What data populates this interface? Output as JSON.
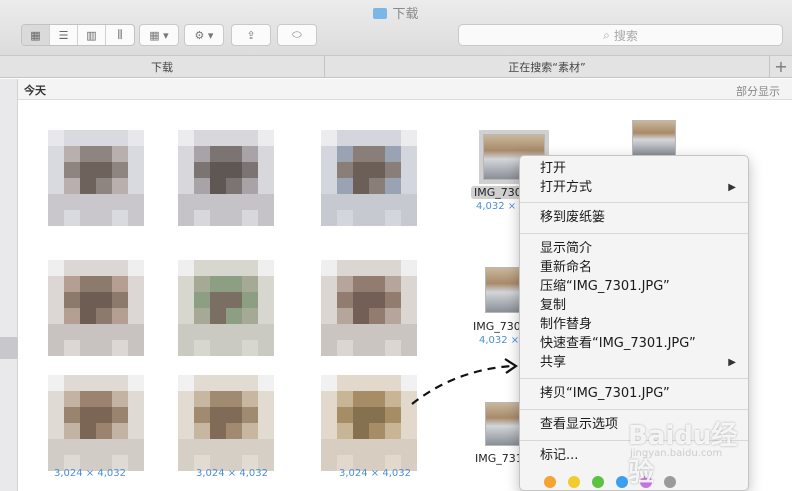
{
  "window": {
    "title": "下载"
  },
  "search": {
    "placeholder": "搜索"
  },
  "tabs": [
    {
      "label": "下载"
    },
    {
      "label": "正在搜索“素材”"
    }
  ],
  "section": {
    "title": "今天",
    "show_less": "部分显示"
  },
  "files": {
    "dims_a": "4,032 × 3,024",
    "dims_b": "3,024 × 4,032",
    "dims_trunc": "4,032 ×",
    "name_1": "IMG_730",
    "name_2": "IMG_730",
    "name_3": "IMG_731"
  },
  "menu": {
    "open": "打开",
    "open_with": "打开方式",
    "trash": "移到废纸篓",
    "get_info": "显示简介",
    "rename": "重新命名",
    "compress": "压缩“IMG_7301.JPG”",
    "duplicate": "复制",
    "make_alias": "制作替身",
    "quick_look": "快速查看“IMG_7301.JPG”",
    "share": "共享",
    "copy": "拷贝“IMG_7301.JPG”",
    "view_options": "查看显示选项",
    "tags": "标记..."
  },
  "tag_colors": [
    "#f5a331",
    "#f2cb2c",
    "#5cc244",
    "#3a9ff0",
    "#c474e6",
    "#9b9b9b"
  ],
  "watermark": {
    "brand": "Baidu经验",
    "url": "jingyan.baidu.com"
  }
}
